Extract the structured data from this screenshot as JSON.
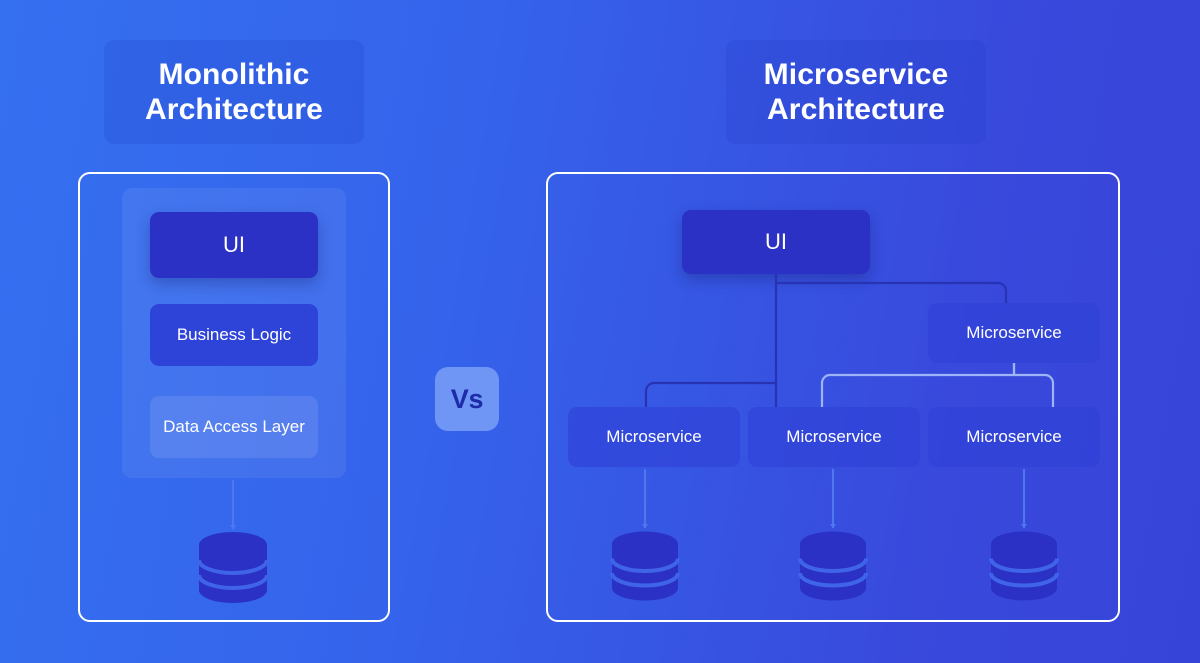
{
  "titles": {
    "monolithic_line1": "Monolithic",
    "monolithic_line2": "Architecture",
    "microservice_line1": "Microservice",
    "microservice_line2": "Architecture"
  },
  "vs_label": "Vs",
  "monolith": {
    "layers": [
      {
        "label": "UI"
      },
      {
        "label": "Business Logic"
      },
      {
        "label": "Data Access Layer"
      }
    ],
    "database_icon": "database-icon"
  },
  "microservice": {
    "ui_label": "UI",
    "services": [
      {
        "label": "Microservice",
        "position": "right-upper"
      },
      {
        "label": "Microservice",
        "position": "bottom-left"
      },
      {
        "label": "Microservice",
        "position": "bottom-center"
      },
      {
        "label": "Microservice",
        "position": "bottom-right"
      }
    ],
    "database_icons": [
      "database-icon",
      "database-icon",
      "database-icon"
    ]
  },
  "colors": {
    "background_start": "#3570F0",
    "background_end": "#3744D8",
    "node_strong": "#2A31C4",
    "node_mid": "#2E44D8",
    "vs_badge_bg": "#7096F5",
    "vs_badge_text": "#1E2BA8",
    "border_white": "#FFFFFF",
    "connector_dark": "#2833B4",
    "connector_light": "#9DB4F7",
    "arrow": "#4E78EE"
  }
}
